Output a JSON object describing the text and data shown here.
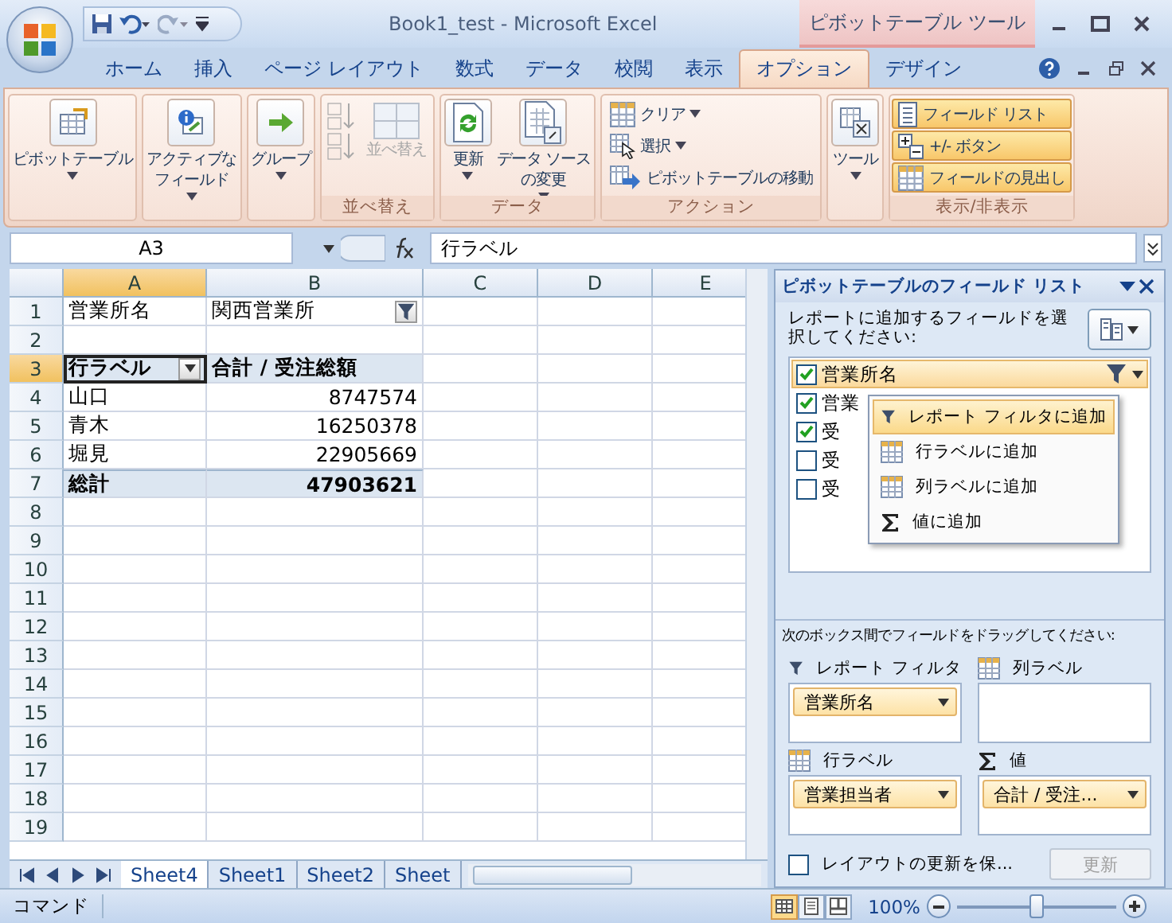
{
  "title_bar": {
    "title": "Book1_test - Microsoft Excel",
    "context_tab": "ピボットテーブル ツール"
  },
  "ribbon_tabs": [
    {
      "label": "ホーム",
      "selected": false
    },
    {
      "label": "挿入",
      "selected": false
    },
    {
      "label": "ページ レイアウト",
      "selected": false
    },
    {
      "label": "数式",
      "selected": false
    },
    {
      "label": "データ",
      "selected": false
    },
    {
      "label": "校閲",
      "selected": false
    },
    {
      "label": "表示",
      "selected": false
    },
    {
      "label": "オプション",
      "selected": true
    },
    {
      "label": "デザイン",
      "selected": false
    }
  ],
  "ribbon_groups": [
    {
      "buttons": [
        {
          "kind": "large",
          "label": [
            "ピボットテーブル"
          ],
          "dropdown": true
        }
      ]
    },
    {
      "buttons": [
        {
          "kind": "large",
          "label": [
            "アクティブな",
            "フィールド"
          ],
          "dropdown": true
        }
      ]
    },
    {
      "buttons": [
        {
          "kind": "large",
          "label": [
            "グループ"
          ],
          "dropdown": true
        }
      ]
    },
    {
      "label": "並べ替え",
      "buttons": [
        {
          "kind": "sort",
          "label": "並べ替え",
          "disabled": true
        }
      ]
    },
    {
      "label": "データ",
      "buttons": [
        {
          "kind": "large",
          "label": [
            "更新"
          ],
          "dropdown": true
        },
        {
          "kind": "large",
          "label": [
            "データ ソース",
            "の変更"
          ],
          "dropdown": true
        }
      ]
    },
    {
      "label": "アクション",
      "buttons": [
        {
          "kind": "small",
          "label": "クリア",
          "dropdown": true
        },
        {
          "kind": "small",
          "label": "選択",
          "dropdown": true
        },
        {
          "kind": "small",
          "label": "ピボットテーブルの移動",
          "dropdown": false
        }
      ]
    },
    {
      "buttons": [
        {
          "kind": "large",
          "label": [
            "ツール"
          ],
          "dropdown": true
        }
      ]
    },
    {
      "label": "表示/非表示",
      "buttons": [
        {
          "kind": "toggle",
          "label": "フィールド リスト",
          "on": true
        },
        {
          "kind": "toggle",
          "label": "+/- ボタン",
          "on": true
        },
        {
          "kind": "toggle",
          "label": "フィールドの見出し",
          "on": true
        }
      ]
    }
  ],
  "formula_bar": {
    "name_box": "A3",
    "formula": "行ラベル"
  },
  "sheet": {
    "columns": [
      {
        "label": "A",
        "selected": true
      },
      {
        "label": "B",
        "selected": false
      },
      {
        "label": "C",
        "selected": false
      },
      {
        "label": "D",
        "selected": false
      },
      {
        "label": "E",
        "selected": false
      }
    ],
    "rows": [
      {
        "number": "1",
        "selected": false,
        "kind": "filter",
        "cells": [
          "営業所名",
          "関西営業所"
        ]
      },
      {
        "number": "2",
        "selected": false,
        "kind": "empty"
      },
      {
        "number": "3",
        "selected": true,
        "kind": "header",
        "cells": [
          "行ラベル",
          "合計 / 受注総額"
        ]
      },
      {
        "number": "4",
        "selected": false,
        "kind": "item",
        "cells": [
          "山口",
          "8747574"
        ]
      },
      {
        "number": "5",
        "selected": false,
        "kind": "item",
        "cells": [
          "青木",
          "16250378"
        ]
      },
      {
        "number": "6",
        "selected": false,
        "kind": "item",
        "cells": [
          "堀見",
          "22905669"
        ]
      },
      {
        "number": "7",
        "selected": false,
        "kind": "total",
        "cells": [
          "総計",
          "47903621"
        ]
      },
      {
        "number": "8",
        "selected": false,
        "kind": "empty"
      },
      {
        "number": "9",
        "selected": false,
        "kind": "empty"
      },
      {
        "number": "10",
        "selected": false,
        "kind": "empty"
      },
      {
        "number": "11",
        "selected": false,
        "kind": "empty"
      },
      {
        "number": "12",
        "selected": false,
        "kind": "empty"
      },
      {
        "number": "13",
        "selected": false,
        "kind": "empty"
      },
      {
        "number": "14",
        "selected": false,
        "kind": "empty"
      },
      {
        "number": "15",
        "selected": false,
        "kind": "empty"
      },
      {
        "number": "16",
        "selected": false,
        "kind": "empty"
      },
      {
        "number": "17",
        "selected": false,
        "kind": "empty"
      },
      {
        "number": "18",
        "selected": false,
        "kind": "empty"
      },
      {
        "number": "19",
        "selected": false,
        "kind": "empty"
      }
    ]
  },
  "sheet_tabs": [
    {
      "label": "Sheet4",
      "selected": true
    },
    {
      "label": "Sheet1",
      "selected": false
    },
    {
      "label": "Sheet2",
      "selected": false
    },
    {
      "label": "Sheet",
      "selected": false
    }
  ],
  "field_list": {
    "title": "ピボットテーブルのフィールド リスト",
    "instruction": "レポートに追加するフィールドを選択してください:",
    "fields": [
      {
        "label": "営業所名",
        "checked": true,
        "selected": true
      },
      {
        "label": "営業",
        "checked": true,
        "selected": false
      },
      {
        "label": "受",
        "checked": true,
        "selected": false
      },
      {
        "label": "受",
        "checked": false,
        "selected": false
      },
      {
        "label": "受",
        "checked": false,
        "selected": false
      }
    ],
    "context_menu": [
      {
        "kind": "filter",
        "label": "レポート フィルタに追加",
        "selected": true
      },
      {
        "kind": "grid",
        "label": "行ラベルに追加",
        "selected": false
      },
      {
        "kind": "grid",
        "label": "列ラベルに追加",
        "selected": false
      },
      {
        "kind": "sum",
        "label": "値に追加",
        "selected": false
      }
    ],
    "drag_instruction": "次のボックス間でフィールドをドラッグしてください:",
    "areas": [
      {
        "kind": "filter",
        "label": "レポート フィルタ",
        "fields": [
          "営業所名"
        ]
      },
      {
        "kind": "grid",
        "label": "列ラベル"
      },
      {
        "kind": "grid",
        "label": "行ラベル",
        "fields": [
          "営業担当者"
        ]
      },
      {
        "kind": "sum",
        "label": "値",
        "fields": [
          "合計 / 受注..."
        ]
      }
    ],
    "defer_update": {
      "label": "レイアウトの更新を保...",
      "checked": false
    },
    "update_button": {
      "label": "更新",
      "disabled": true
    }
  },
  "status_bar": {
    "mode": "コマンド",
    "views": [
      {
        "kind": "normal",
        "selected": true
      },
      {
        "kind": "layout",
        "selected": false
      },
      {
        "kind": "pagebreak",
        "selected": false
      }
    ],
    "zoom": "100%",
    "zoom_slider": {
      "level": 0.5
    }
  }
}
